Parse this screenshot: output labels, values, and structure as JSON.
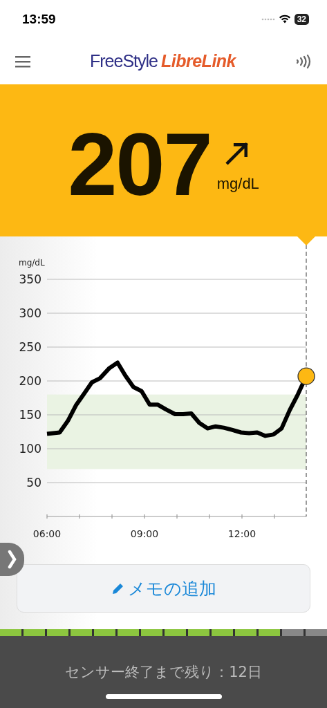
{
  "status_bar": {
    "time": "13:59",
    "battery": "32"
  },
  "header": {
    "brand_first": "FreeStyle",
    "brand_second": "LibreLink"
  },
  "reading": {
    "value": "207",
    "unit": "mg/dL",
    "trend_arrow": {
      "kind": "rising"
    }
  },
  "chart": {
    "chart_data": {
      "type": "line",
      "ylabel": "mg/dL",
      "x": [
        6.0,
        6.39,
        6.64,
        6.89,
        7.14,
        7.38,
        7.63,
        7.92,
        8.17,
        8.41,
        8.66,
        8.91,
        9.16,
        9.41,
        9.66,
        9.94,
        10.19,
        10.44,
        10.69,
        10.94,
        11.19,
        11.44,
        11.69,
        11.97,
        12.22,
        12.47,
        12.72,
        12.97,
        13.22,
        13.47,
        13.72,
        13.98
      ],
      "series": [
        {
          "color": "#000000",
          "values": [
            122,
            124,
            141,
            164,
            181,
            198,
            204,
            219,
            227,
            208,
            191,
            185,
            165,
            165,
            158,
            151,
            151,
            152,
            138,
            130,
            133,
            131,
            128,
            124,
            123,
            124,
            119,
            121,
            130,
            157,
            180,
            207
          ]
        }
      ],
      "xlim": [
        6,
        14
      ],
      "ylim": [
        0,
        350
      ],
      "xticks": [
        {
          "value": 6,
          "label": "06:00"
        },
        {
          "value": 9,
          "label": "09:00"
        },
        {
          "value": 12,
          "label": "12:00"
        }
      ],
      "yticks": [
        50,
        100,
        150,
        200,
        250,
        300,
        350
      ],
      "grid": true,
      "bands": [
        {
          "axis": "y",
          "from": 70,
          "to": 180
        }
      ]
    }
  },
  "memo_button": {
    "label": "メモの追加"
  },
  "sensor": {
    "level": 0.857,
    "text": "センサー終了まで残り：12日"
  }
}
